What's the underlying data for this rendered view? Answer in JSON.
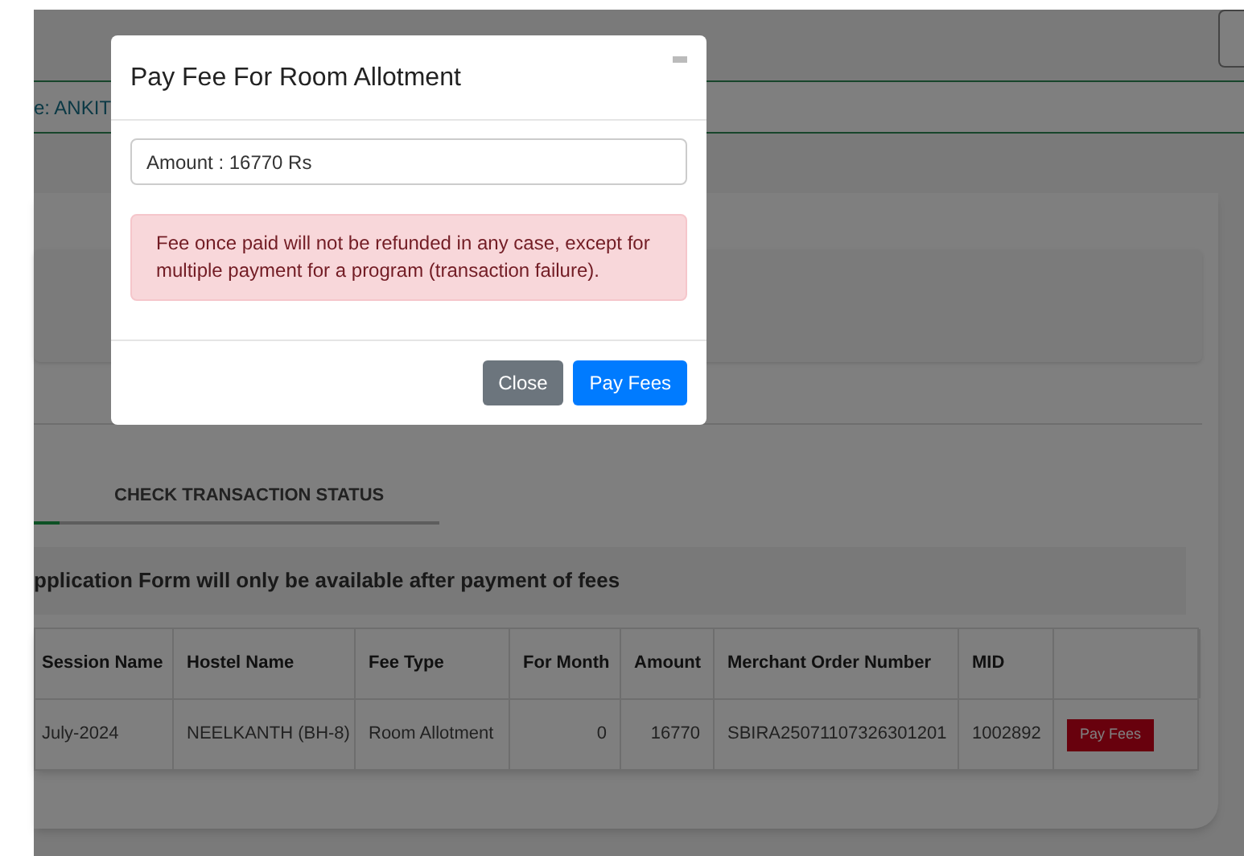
{
  "header": {
    "name_text": "e: ANKIT"
  },
  "tabs": [
    {
      "selected": true
    },
    {
      "label": "CHECK TRANSACTION STATUS",
      "selected": false
    }
  ],
  "notice": "pplication Form will only be available after payment of fees",
  "table": {
    "columns": [
      "Session Name",
      "Hostel Name",
      "Fee Type",
      "For Month",
      "Amount",
      "Merchant Order Number",
      "MID",
      null
    ],
    "rows": [
      {
        "cells": [
          "July-2024",
          "NEELKANTH (BH-8)",
          "Room Allotment",
          "0",
          "16770",
          "SBIRA25071107326301201",
          "1002892"
        ],
        "action": "Pay Fees"
      }
    ]
  },
  "modal": {
    "title": "Pay Fee For Room Allotment",
    "amount": "Amount : 16770 Rs",
    "alert": "Fee once paid will not be refunded in any case, except for multiple payment for a program (transaction failure).",
    "buttons": [
      {
        "label": "Close",
        "kind": "secondary"
      },
      {
        "label": "Pay Fees",
        "kind": "primary"
      }
    ]
  }
}
